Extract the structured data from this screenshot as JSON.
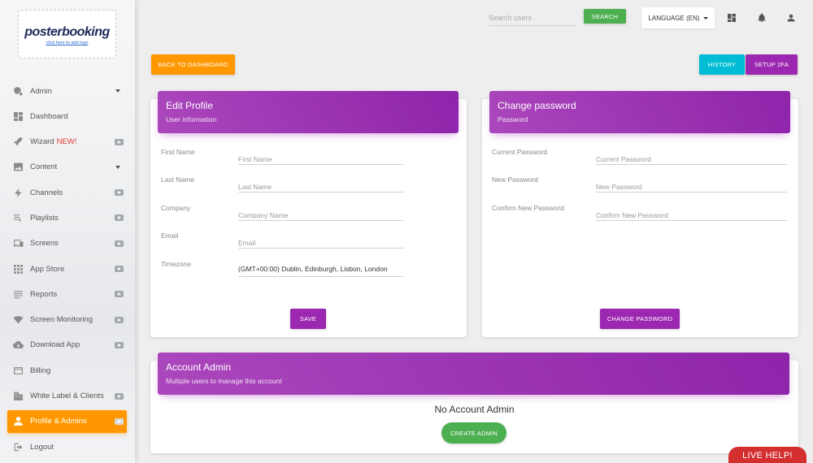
{
  "sidebar": {
    "logo": {
      "brand": "posterbooking",
      "sub": "click here to add logo"
    },
    "items": [
      {
        "label": "Admin",
        "icon": "admin-gear-icon",
        "trailing": "caret"
      },
      {
        "label": "Dashboard",
        "icon": "dashboard-icon",
        "trailing": ""
      },
      {
        "label": "Wizard",
        "badge": "NEW!",
        "icon": "rocket-icon",
        "trailing": "video"
      },
      {
        "label": "Content",
        "icon": "image-icon",
        "trailing": "caret"
      },
      {
        "label": "Channels",
        "icon": "lightning-icon",
        "trailing": "video"
      },
      {
        "label": "Playlists",
        "icon": "playlist-icon",
        "trailing": "video"
      },
      {
        "label": "Screens",
        "icon": "devices-icon",
        "trailing": "video"
      },
      {
        "label": "App Store",
        "icon": "apps-grid-icon",
        "trailing": "video"
      },
      {
        "label": "Reports",
        "icon": "reports-list-icon",
        "trailing": "video"
      },
      {
        "label": "Screen Monitoring",
        "icon": "wifi-icon",
        "trailing": "video"
      },
      {
        "label": "Download App",
        "icon": "cloud-download-icon",
        "trailing": "video"
      },
      {
        "label": "Billing",
        "icon": "credit-card-icon",
        "trailing": ""
      },
      {
        "label": "White Label & Clients",
        "icon": "building-icon",
        "trailing": "video"
      },
      {
        "label": "Profile & Admins",
        "icon": "person-icon",
        "trailing": "video",
        "active": true
      },
      {
        "label": "Logout",
        "icon": "logout-icon",
        "trailing": ""
      }
    ]
  },
  "topbar": {
    "search_placeholder": "Search users",
    "search_button": "SEARCH",
    "language_label": "LANGUAGE (EN)",
    "icons": [
      "dashboard-grid-icon",
      "bell-icon",
      "user-icon"
    ]
  },
  "actions": {
    "back_label": "BACK TO DASHBOARD",
    "history_label": "HISTORY",
    "setup2fa_label": "SETUP 2FA"
  },
  "edit_profile": {
    "title": "Edit Profile",
    "subtitle": "User information",
    "fields": [
      {
        "label": "First Name",
        "placeholder": "First Name",
        "value": ""
      },
      {
        "label": "Last Name",
        "placeholder": "Last Name",
        "value": ""
      },
      {
        "label": "Company",
        "placeholder": "Company Name",
        "value": ""
      },
      {
        "label": "Email",
        "placeholder": "Email",
        "value": ""
      }
    ],
    "timezone": {
      "label": "Timezone",
      "value": "(GMT+00:00) Dublin, Edinburgh, Lisbon, London"
    },
    "save_label": "SAVE"
  },
  "change_password": {
    "title": "Change password",
    "subtitle": "Password",
    "fields": [
      {
        "label": "Current Password",
        "placeholder": "Current Password"
      },
      {
        "label": "New Password",
        "placeholder": "New Password"
      },
      {
        "label": "Confirm New Password",
        "placeholder": "Confirm New Password"
      }
    ],
    "submit_label": "CHANGE PASSWORD"
  },
  "account_admin": {
    "title": "Account Admin",
    "subtitle": "Multiple users to manage this account",
    "empty_text": "No Account Admin",
    "create_label": "CREATE ADMIN"
  },
  "live_help": "LIVE HELP!",
  "colors": {
    "primary_purple": "#9c27b0",
    "orange": "#ff9800",
    "green": "#4caf50",
    "cyan": "#00bcd4",
    "red": "#d32f2f"
  }
}
